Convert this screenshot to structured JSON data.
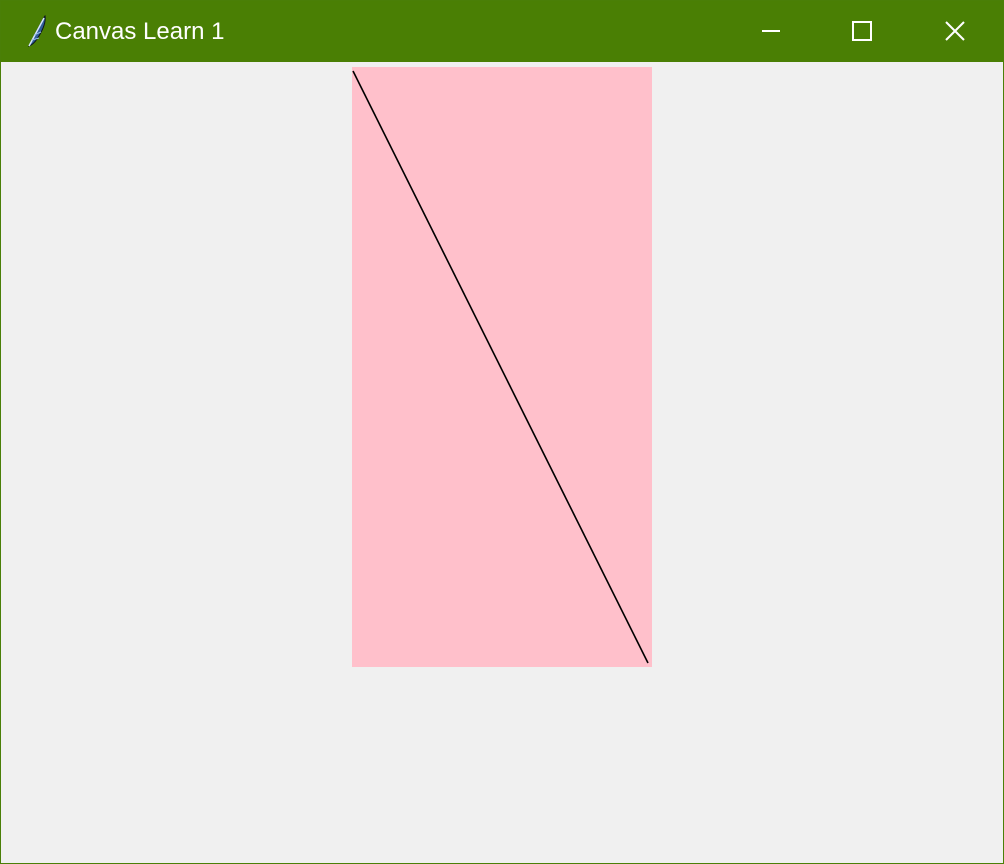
{
  "window": {
    "title": "Canvas Learn 1",
    "titlebar_color": "#4a7f04",
    "client_background": "#f0f0f0",
    "icons": {
      "app": "feather-icon",
      "minimize": "minimize-icon",
      "maximize": "maximize-icon",
      "close": "close-icon"
    }
  },
  "canvas": {
    "background": "#ffc0cb",
    "line_color": "#000000"
  }
}
